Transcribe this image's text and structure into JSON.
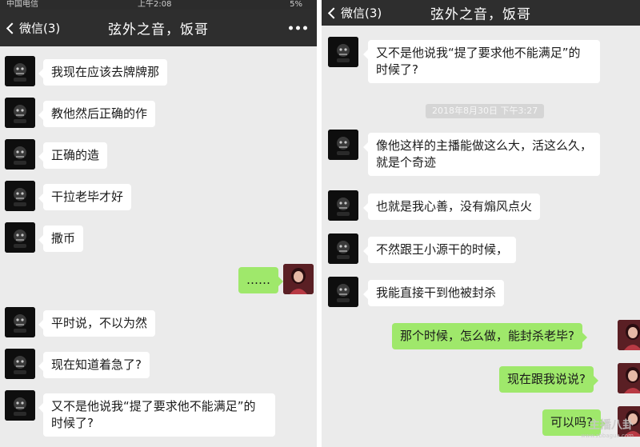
{
  "left": {
    "status": {
      "carrier": "中国电信",
      "time": "上午2:08",
      "battery": "5%"
    },
    "nav": {
      "back_label": "微信(3)",
      "title": "弦外之音，饭哥"
    },
    "messages": [
      {
        "side": "in",
        "text": "我现在应该去牌牌那"
      },
      {
        "side": "in",
        "text": "教他然后正确的作"
      },
      {
        "side": "in",
        "text": "正确的造"
      },
      {
        "side": "in",
        "text": "干拉老毕才好"
      },
      {
        "side": "in",
        "text": "撒币"
      },
      {
        "side": "out",
        "text": "……"
      },
      {
        "side": "in",
        "text": "平时说，不以为然"
      },
      {
        "side": "in",
        "text": "现在知道着急了?"
      },
      {
        "side": "in",
        "text": "又不是他说我“提了要求他不能满足”的时候了?"
      }
    ]
  },
  "right": {
    "nav": {
      "back_label": "微信(3)",
      "title": "弦外之音，饭哥"
    },
    "timestamp": "2018年8月30日 下午3:27",
    "messages": [
      {
        "side": "in",
        "text": "又不是他说我“提了要求他不能满足”的时候了?"
      },
      {
        "side": "in",
        "text": "像他这样的主播能做这么大，活这么久，就是个奇迹"
      },
      {
        "side": "in",
        "text": "也就是我心善，没有煽风点火"
      },
      {
        "side": "in",
        "text": "不然跟王小源干的时候，"
      },
      {
        "side": "in",
        "text": "我能直接干到他被封杀"
      },
      {
        "side": "out",
        "text": "那个时候，怎么做，能封杀老毕?"
      },
      {
        "side": "out",
        "text": "现在跟我说说?"
      },
      {
        "side": "out",
        "text": "可以吗?"
      }
    ],
    "watermark": {
      "text": "主播八卦",
      "url": "www.zbbagua.com"
    }
  },
  "colors": {
    "nav_bg": "#2e2e2e",
    "chat_bg": "#ebebeb",
    "bubble_out": "#9fe86b",
    "bubble_in": "#ffffff"
  },
  "icons": {
    "back": "chevron-left-icon",
    "more": "more-dots-icon",
    "friend_avatar": "friend-avatar",
    "me_avatar": "my-avatar"
  }
}
